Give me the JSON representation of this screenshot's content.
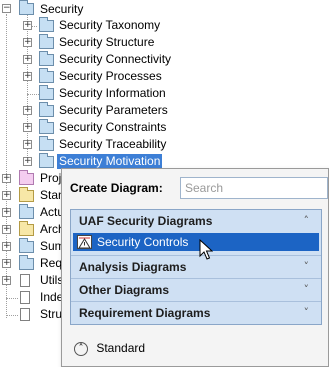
{
  "tree": {
    "root_label": "Security",
    "children": [
      "Security Taxonomy",
      "Security Structure",
      "Security Connectivity",
      "Security Processes",
      "Security Information",
      "Security Parameters",
      "Security Constraints",
      "Security Traceability",
      "Security Motivation"
    ],
    "siblings": [
      "Proj",
      "Stan",
      "Actu",
      "Arch",
      "Sum",
      "Requ",
      "Utils",
      "Inde",
      "Stru"
    ]
  },
  "popup": {
    "create_label": "Create Diagram:",
    "search_placeholder": "Search",
    "sections": [
      {
        "title": "UAF Security Diagrams",
        "state": "expanded"
      },
      {
        "title": "Analysis Diagrams",
        "state": "collapsed"
      },
      {
        "title": "Other Diagrams",
        "state": "collapsed"
      },
      {
        "title": "Requirement Diagrams",
        "state": "collapsed"
      }
    ],
    "highlighted_item": "Security Controls",
    "footer_label": "Standard",
    "expand_glyph": "˄",
    "collapse_glyph": "˅",
    "footer_glyph": "˄"
  },
  "colors": {
    "selection": "#3d7fd6",
    "popup_item_highlight": "#1c64c4",
    "panel_bg": "#cfe0f3"
  }
}
